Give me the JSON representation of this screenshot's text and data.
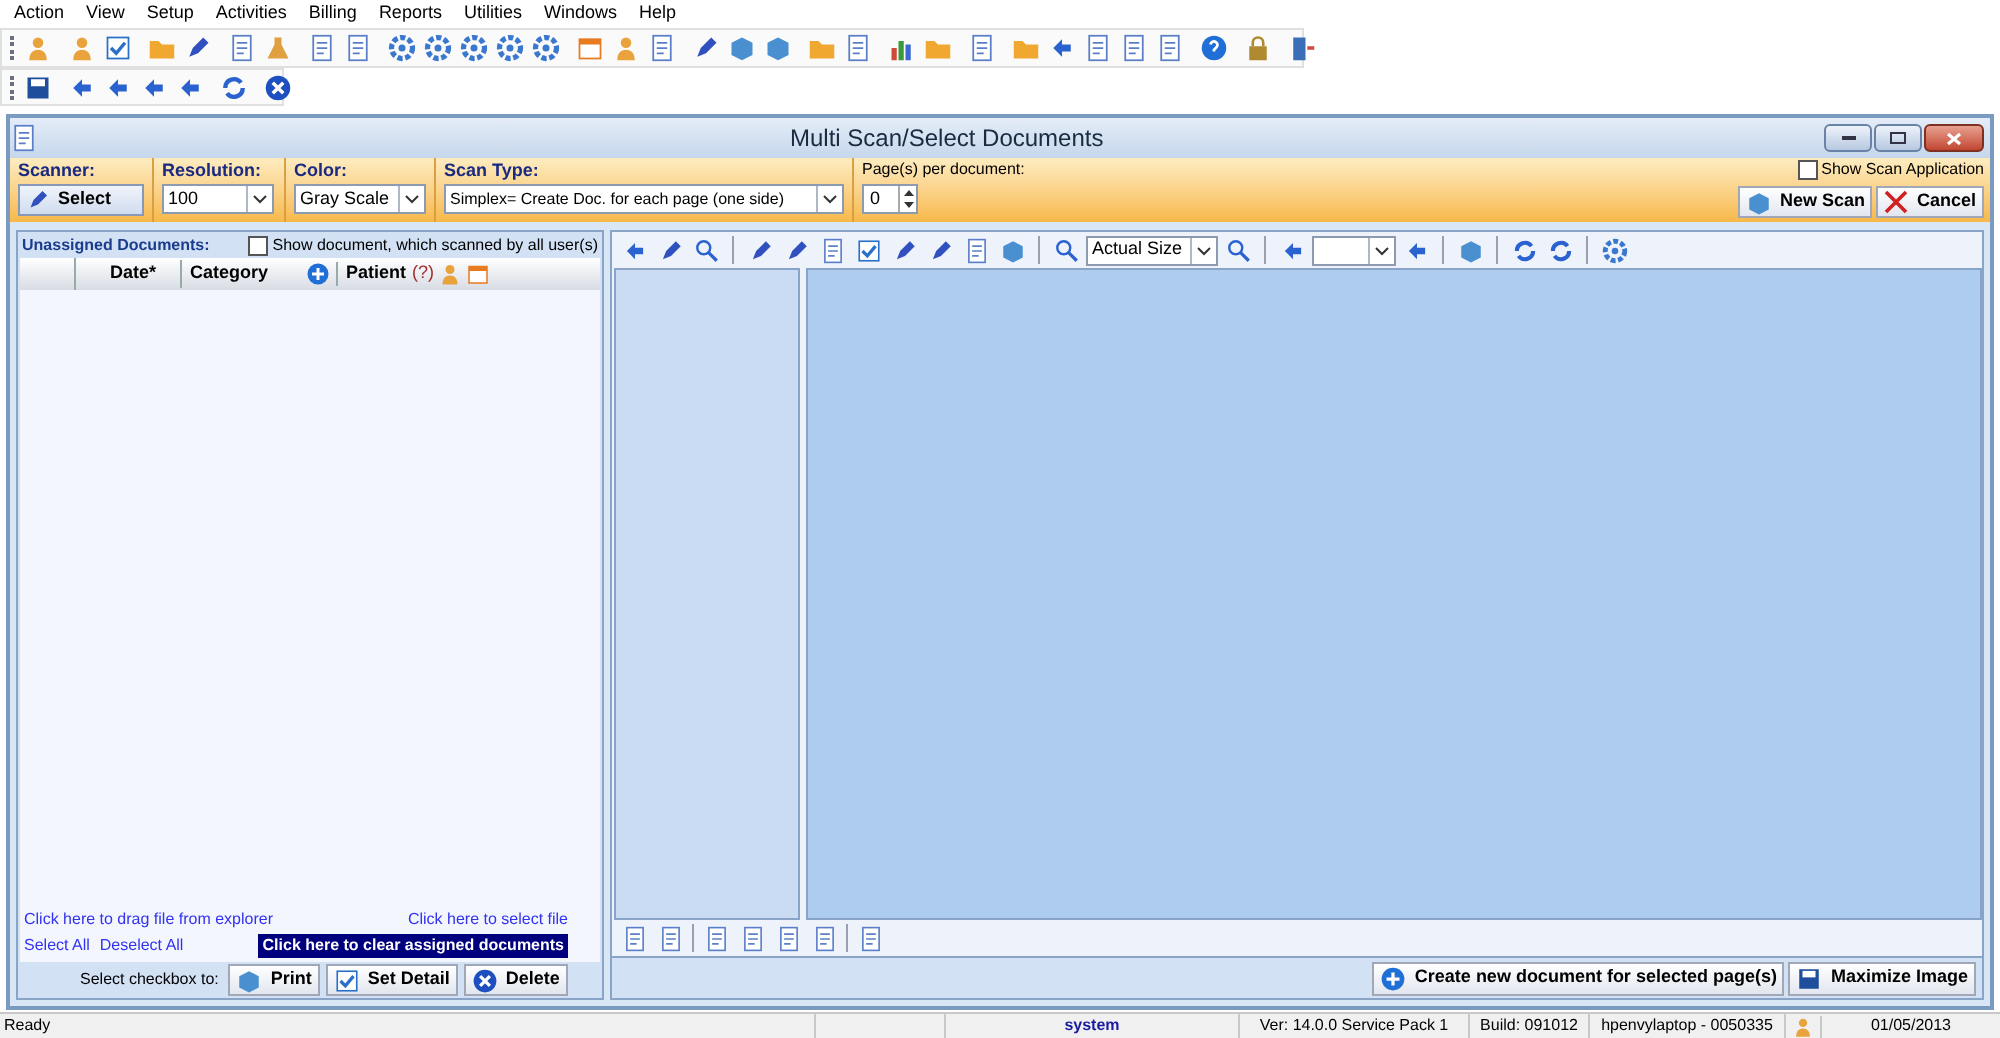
{
  "menu": [
    "Action",
    "View",
    "Setup",
    "Activities",
    "Billing",
    "Reports",
    "Utilities",
    "Windows",
    "Help"
  ],
  "window": {
    "title": "Multi Scan/Select Documents"
  },
  "scan_bar": {
    "scanner": {
      "label": "Scanner:",
      "button": "Select"
    },
    "resolution": {
      "label": "Resolution:",
      "value": "100"
    },
    "color": {
      "label": "Color:",
      "value": "Gray Scale"
    },
    "scan_type": {
      "label": "Scan Type:",
      "value": "Simplex= Create Doc. for each page (one side)"
    },
    "pages": {
      "label": "Page(s) per document:",
      "value": "0"
    },
    "show_scan_application": {
      "label": "Show Scan Application",
      "checked": false
    },
    "buttons": [
      {
        "kind": "scan",
        "label": "New Scan"
      },
      {
        "kind": "cancel",
        "label": "Cancel"
      }
    ]
  },
  "unassigned": {
    "title": "Unassigned Documents:",
    "show_all": {
      "label": "Show document, which scanned by all user(s)",
      "checked": false
    },
    "columns": [
      "Date*",
      "Category"
    ],
    "patient": {
      "label": "Patient",
      "hint": "(?)"
    },
    "drag_link": "Click here to drag file from explorer",
    "select_file_link": "Click here to select file",
    "select_all": "Select All",
    "deselect_all": "Deselect All",
    "clear_button": "Click here to clear assigned documents",
    "action_label": "Select checkbox to:",
    "actions": [
      {
        "kind": "print",
        "label": "Print"
      },
      {
        "kind": "detail",
        "label": "Set Detail"
      },
      {
        "kind": "delete",
        "label": "Delete"
      }
    ]
  },
  "viewer": {
    "zoom": "Actual Size",
    "buttons": [
      {
        "kind": "create",
        "label": "Create new document for selected page(s)"
      },
      {
        "kind": "maximize",
        "label": "Maximize Image"
      }
    ]
  },
  "status_bar": {
    "message": "Ready",
    "user": "system",
    "version": "Ver: 14.0.0 Service Pack 1",
    "build": "Build: 091012",
    "machine": "hpenvylaptop - 0050335",
    "date": "01/05/2013"
  }
}
